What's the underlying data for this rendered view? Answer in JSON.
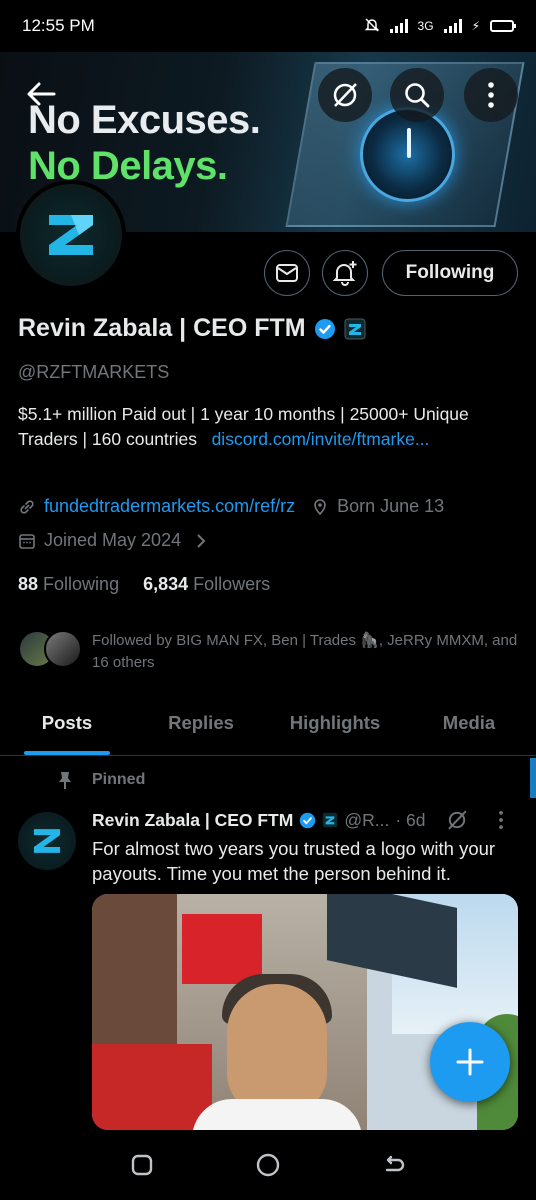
{
  "status_bar": {
    "time": "12:55 PM",
    "network": "3G"
  },
  "banner": {
    "line1": "No Excuses.",
    "line2": "No Delays."
  },
  "profile": {
    "name": "Revin Zabala | CEO FTM",
    "handle": "@RZFTMARKETS",
    "bio_text": "$5.1+ million Paid out | 1 year 10 months | 25000+ Unique Traders | 160 countries",
    "bio_link": "discord.com/invite/ftmarke...",
    "website": "fundedtradermarkets.com/ref/rz",
    "born": "Born June 13",
    "joined": "Joined May 2024",
    "following_count": "88",
    "following_label": "Following",
    "followers_count": "6,834",
    "followers_label": "Followers",
    "followed_by": "Followed by BIG MAN FX, Ben | Trades 🦍, JeRRy MMXM, and 16 others"
  },
  "actions": {
    "following_button": "Following"
  },
  "tabs": [
    {
      "label": "Posts"
    },
    {
      "label": "Replies"
    },
    {
      "label": "Highlights"
    },
    {
      "label": "Media"
    }
  ],
  "post": {
    "pinned_label": "Pinned",
    "author_name": "Revin Zabala | CEO FTM",
    "author_handle": "@R...",
    "time": "· 6d",
    "text": "For almost two years you trusted a logo with your payouts. Time you met the person behind it."
  },
  "colors": {
    "accent": "#1d9bf0",
    "banner_green": "#5fe16a",
    "muted": "#71767b"
  }
}
